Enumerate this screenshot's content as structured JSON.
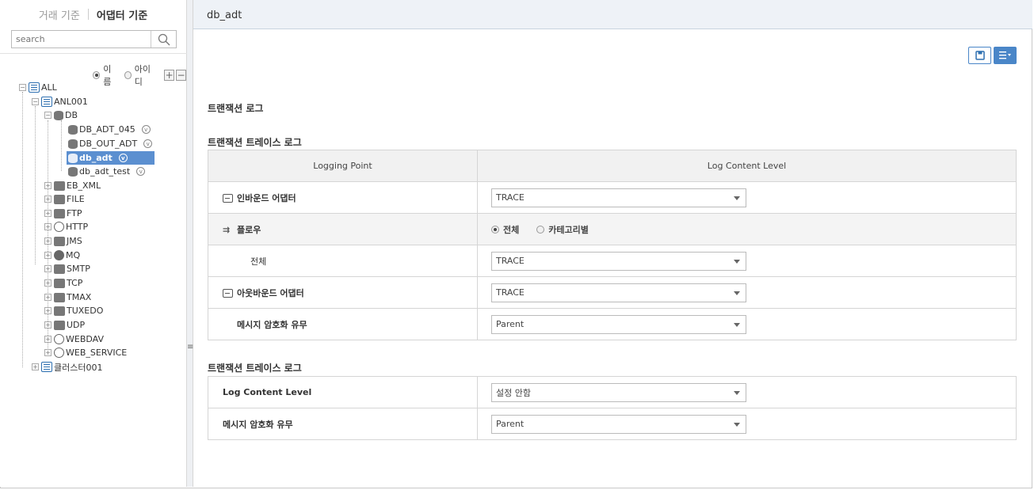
{
  "left": {
    "tabs": [
      "거래 기준",
      "어댑터 기준"
    ],
    "active_tab": 1,
    "search_placeholder": "search",
    "radio_name": "이름",
    "radio_id": "아이디",
    "tree": {
      "root": "ALL",
      "anl": "ANL001",
      "db": "DB",
      "db_items": [
        "DB_ADT_045",
        "DB_OUT_ADT",
        "db_adt",
        "db_adt_test"
      ],
      "adapters": [
        "EB_XML",
        "FILE",
        "FTP",
        "HTTP",
        "JMS",
        "MQ",
        "SMTP",
        "TCP",
        "TMAX",
        "TUXEDO",
        "UDP",
        "WEBDAV",
        "WEB_SERVICE"
      ],
      "cluster": "클러스터001"
    }
  },
  "header": {
    "title": "db_adt"
  },
  "section1": {
    "title": "트랜잭션 로그"
  },
  "section2": {
    "title": "트랜잭션 트레이스 로그",
    "col1": "Logging Point",
    "col2": "Log Content Level",
    "rows": {
      "inbound": {
        "label": "인바운드 어댑터",
        "value": "TRACE"
      },
      "flow": {
        "label": "플로우",
        "opt_all": "전체",
        "opt_cat": "카테고리별"
      },
      "all": {
        "label": "전체",
        "value": "TRACE"
      },
      "outbound": {
        "label": "아웃바운드 어댑터",
        "value": "TRACE"
      },
      "encrypt": {
        "label": "메시지 암호화 유무",
        "value": "Parent"
      }
    }
  },
  "section3": {
    "title": "트랜잭션 트레이스 로그",
    "rows": {
      "level": {
        "label": "Log Content Level",
        "value": "설정 안함"
      },
      "encrypt": {
        "label": "메시지 암호화 유무",
        "value": "Parent"
      }
    }
  },
  "colors": {
    "accent": "#4a86c8",
    "selected": "#5b8fd0"
  }
}
